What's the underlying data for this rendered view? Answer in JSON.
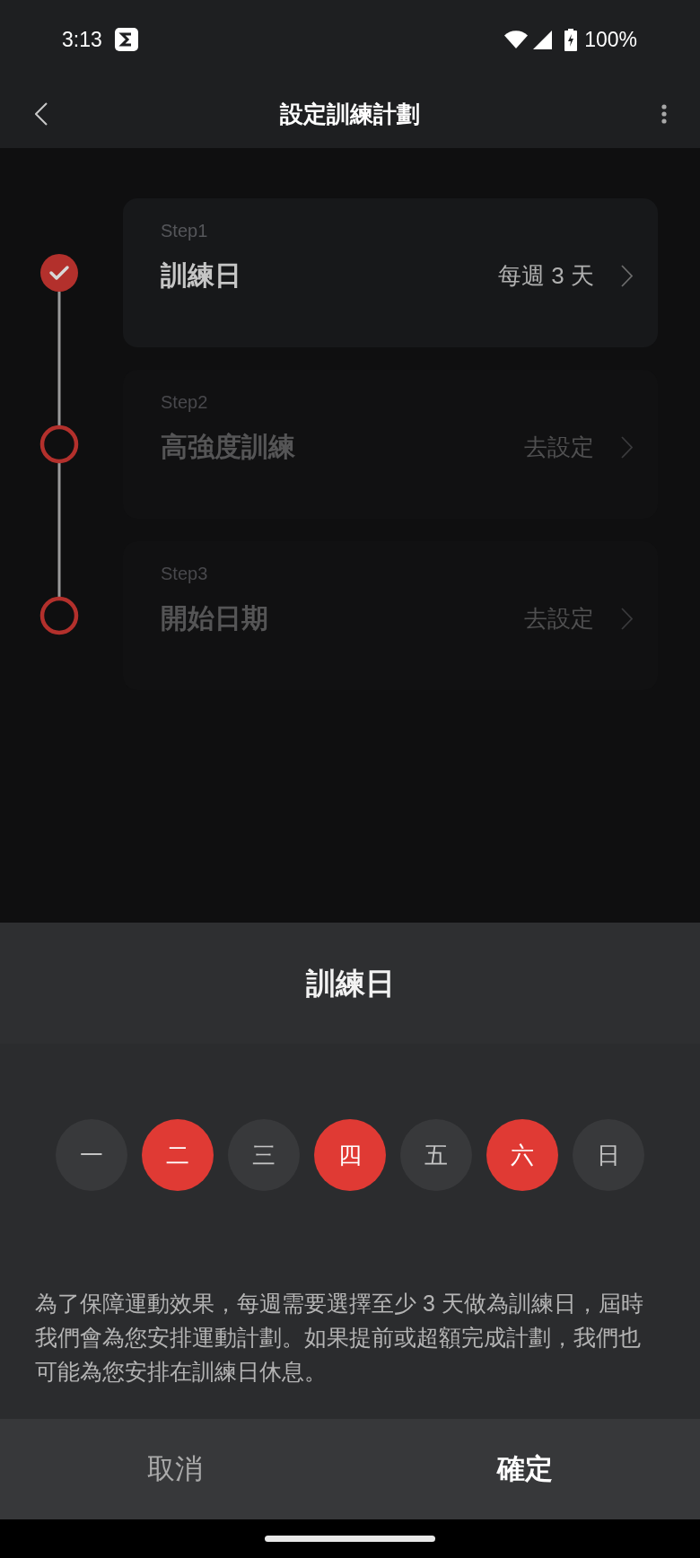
{
  "status_bar": {
    "time": "3:13",
    "battery": "100%"
  },
  "header": {
    "title": "設定訓練計劃"
  },
  "steps": [
    {
      "step": "Step1",
      "title": "訓練日",
      "value": "每週 3 天",
      "done": true
    },
    {
      "step": "Step2",
      "title": "高強度訓練",
      "value": "去設定",
      "done": false
    },
    {
      "step": "Step3",
      "title": "開始日期",
      "value": "去設定",
      "done": false
    }
  ],
  "sheet": {
    "title": "訓練日",
    "days": [
      {
        "label": "一",
        "selected": false
      },
      {
        "label": "二",
        "selected": true
      },
      {
        "label": "三",
        "selected": false
      },
      {
        "label": "四",
        "selected": true
      },
      {
        "label": "五",
        "selected": false
      },
      {
        "label": "六",
        "selected": true
      },
      {
        "label": "日",
        "selected": false
      }
    ],
    "note": "為了保障運動效果，每週需要選擇至少 3 天做為訓練日，屆時我們會為您安排運動計劃。如果提前或超額完成計劃，我們也可能為您安排在訓練日休息。",
    "buttons": [
      {
        "label": "取消",
        "kind": "cancel"
      },
      {
        "label": "確定",
        "kind": "confirm"
      }
    ]
  }
}
